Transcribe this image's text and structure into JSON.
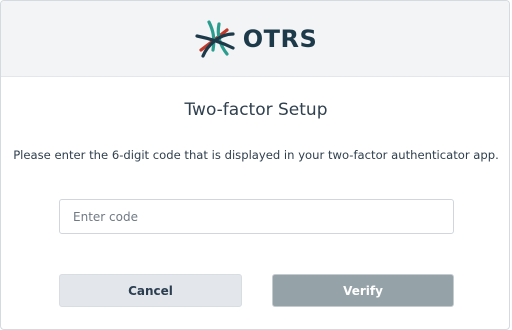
{
  "logo": {
    "text": "OTRS",
    "icon": "otrs-logo-icon",
    "colors": {
      "dark": "#1d3a4a",
      "teal": "#2a9d8f",
      "red": "#c0392b"
    }
  },
  "dialog": {
    "title": "Two-factor Setup",
    "instruction": "Please enter the 6-digit code that is displayed in your two-factor authenticator app.",
    "code_input": {
      "value": "",
      "placeholder": "Enter code"
    },
    "buttons": {
      "cancel_label": "Cancel",
      "verify_label": "Verify"
    }
  },
  "colors": {
    "header_bg": "#f2f4f6",
    "cancel_bg": "#e3e7ec",
    "verify_bg": "#95a3a9"
  }
}
